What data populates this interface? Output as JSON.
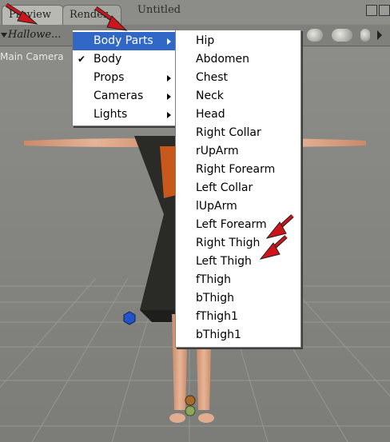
{
  "tabs": [
    {
      "label": "Preview"
    },
    {
      "label": "Render"
    }
  ],
  "document_title": "Untitled",
  "figure_selector": "Hallowe...",
  "camera_label": "Main Camera",
  "menu": {
    "items": [
      {
        "label": "Body Parts",
        "submenu": true,
        "highlighted": true
      },
      {
        "label": "Body",
        "checked": true
      },
      {
        "label": "Props",
        "submenu": true
      },
      {
        "label": "Cameras",
        "submenu": true
      },
      {
        "label": "Lights",
        "submenu": true
      }
    ]
  },
  "submenu": {
    "items": [
      {
        "label": "Hip"
      },
      {
        "label": "Abdomen"
      },
      {
        "label": "Chest"
      },
      {
        "label": "Neck"
      },
      {
        "label": "Head"
      },
      {
        "label": "Right Collar"
      },
      {
        "label": "rUpArm"
      },
      {
        "label": "Right Forearm"
      },
      {
        "label": "Left Collar"
      },
      {
        "label": "lUpArm"
      },
      {
        "label": "Left Forearm"
      },
      {
        "label": "Right Thigh"
      },
      {
        "label": "Left Thigh"
      },
      {
        "label": "fThigh"
      },
      {
        "label": "bThigh"
      },
      {
        "label": "fThigh1"
      },
      {
        "label": "bThigh1"
      }
    ]
  },
  "colors": {
    "menu_highlight": "#3167c6",
    "annotation_arrow": "#d0141c"
  }
}
